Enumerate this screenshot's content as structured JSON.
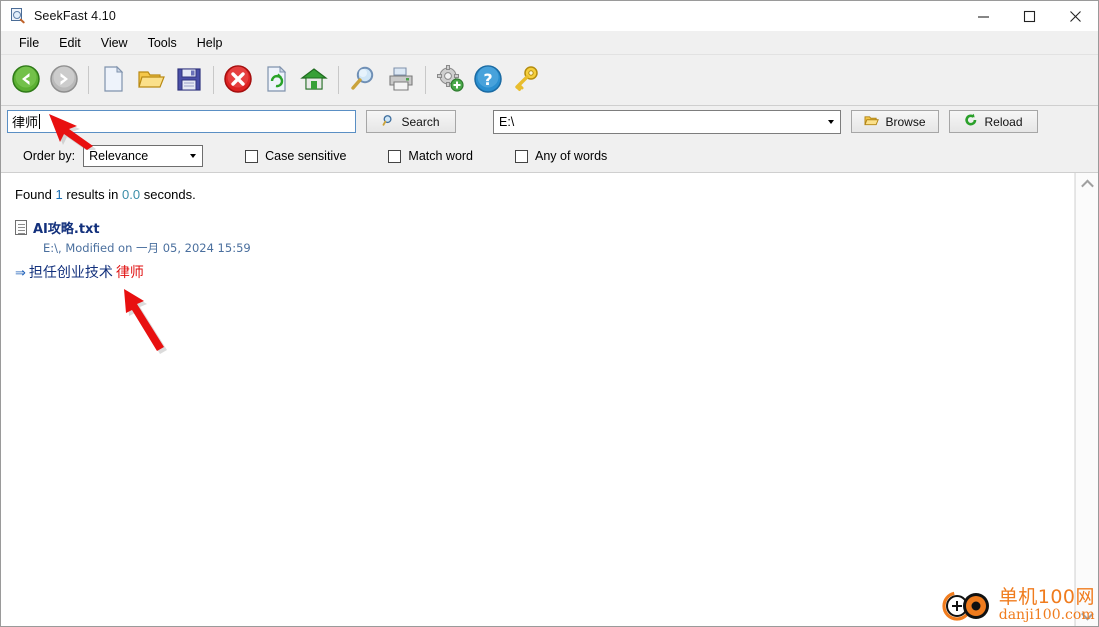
{
  "window": {
    "title": "SeekFast 4.10",
    "app_icon": "magnifier-document-icon",
    "minimize_label": "Minimize",
    "maximize_label": "Maximize",
    "close_label": "Close"
  },
  "menu": {
    "items": [
      {
        "label": "File"
      },
      {
        "label": "Edit"
      },
      {
        "label": "View"
      },
      {
        "label": "Tools"
      },
      {
        "label": "Help"
      }
    ]
  },
  "toolbar": {
    "buttons": [
      {
        "name": "back-icon",
        "title": "Back"
      },
      {
        "name": "forward-icon",
        "title": "Forward"
      },
      {
        "name": "new-document-icon",
        "title": "New"
      },
      {
        "name": "open-folder-icon",
        "title": "Open"
      },
      {
        "name": "save-floppy-icon",
        "title": "Save"
      },
      {
        "name": "stop-icon",
        "title": "Stop"
      },
      {
        "name": "refresh-document-icon",
        "title": "Refresh"
      },
      {
        "name": "home-icon",
        "title": "Home"
      },
      {
        "name": "search-magnifier-icon",
        "title": "Search"
      },
      {
        "name": "print-icon",
        "title": "Print"
      },
      {
        "name": "gear-add-icon",
        "title": "Options"
      },
      {
        "name": "help-icon",
        "title": "Help"
      },
      {
        "name": "key-icon",
        "title": "License"
      }
    ]
  },
  "search": {
    "query": "律师",
    "placeholder": "",
    "search_button_label": "Search",
    "path_value": "E:\\",
    "browse_button_label": "Browse",
    "reload_button_label": "Reload"
  },
  "options": {
    "order_by_label": "Order by:",
    "order_by_value": "Relevance",
    "checkboxes": [
      {
        "label": "Case sensitive",
        "checked": false
      },
      {
        "label": "Match word",
        "checked": false
      },
      {
        "label": "Any of words",
        "checked": false
      }
    ]
  },
  "results": {
    "status_prefix": "Found",
    "status_count": "1",
    "status_middle": "results in",
    "status_seconds": "0.0",
    "status_suffix": "seconds.",
    "items": [
      {
        "file_name": "AI攻略.txt",
        "meta": "E:\\, Modified on 一月  05, 2024 15:59",
        "snippet_arrow": "⇒",
        "snippet_before": "担任创业技术",
        "snippet_highlight": "律师",
        "snippet_after": ""
      }
    ]
  },
  "watermark": {
    "cn": "单机100网",
    "en": "danji100.com"
  },
  "colors": {
    "highlight_red": "#e01010",
    "link_navy": "#12307c",
    "meta_blue": "#4a6f9e",
    "count_blue": "#1a6fb5",
    "watermark_orange": "#f07c1e",
    "focus_border": "#5a8fc4"
  }
}
